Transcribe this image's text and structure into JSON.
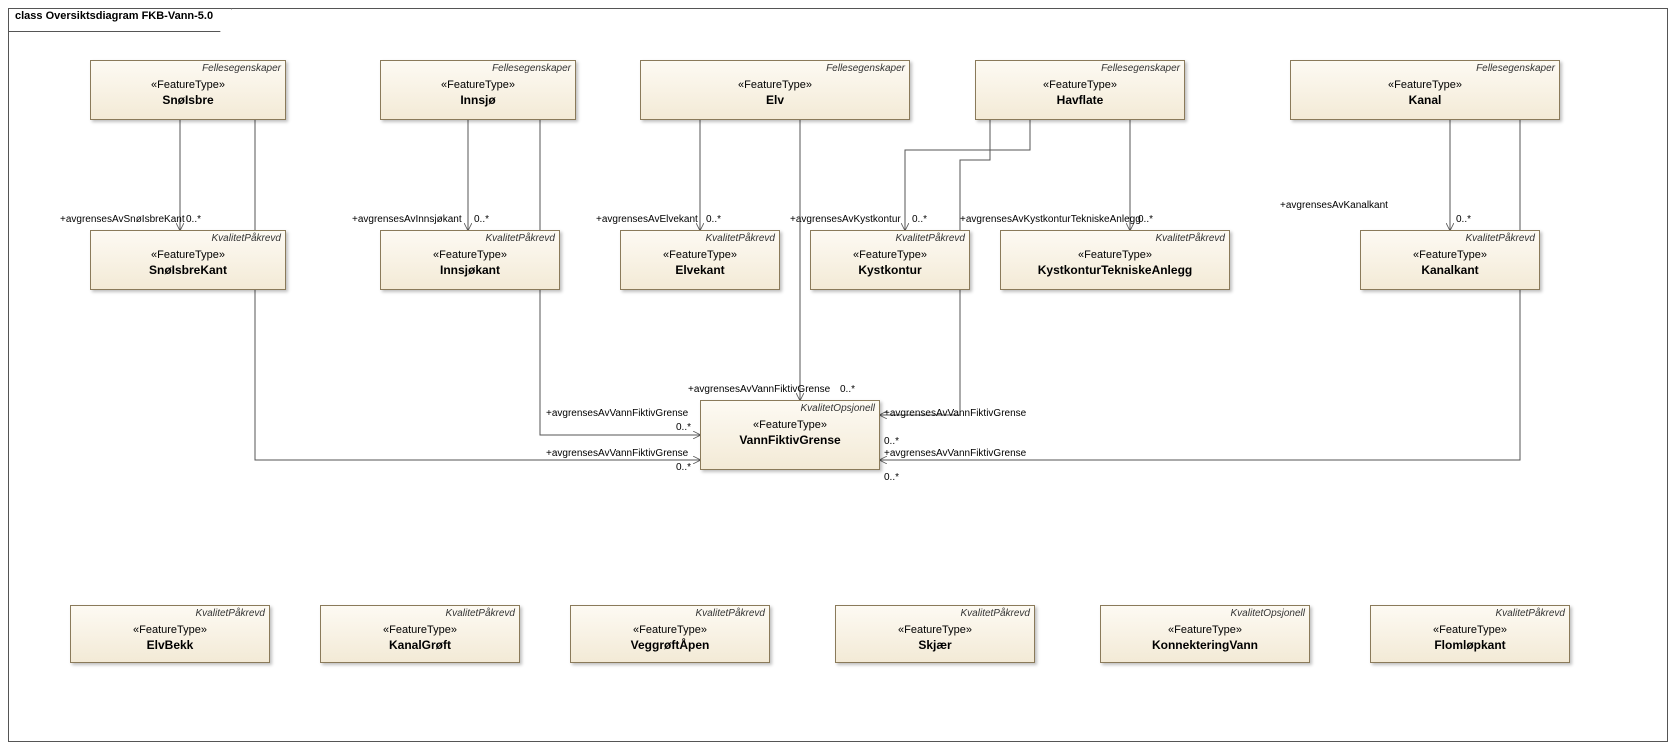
{
  "diagram": {
    "title": "class Oversiktsdiagram FKB-Vann-5.0"
  },
  "stereotype": "«FeatureType»",
  "tags": {
    "felles": "Fellesegenskaper",
    "pakrevd": "KvalitetPåkrevd",
    "opsjonell": "KvalitetOpsjonell"
  },
  "classes": {
    "snoisbre": {
      "name": "SnøIsbre"
    },
    "innsjo": {
      "name": "Innsjø"
    },
    "elv": {
      "name": "Elv"
    },
    "havflate": {
      "name": "Havflate"
    },
    "kanal": {
      "name": "Kanal"
    },
    "snoisbrekant": {
      "name": "SnøIsbreKant"
    },
    "innsjokant": {
      "name": "Innsjøkant"
    },
    "elvekant": {
      "name": "Elvekant"
    },
    "kystkontur": {
      "name": "Kystkontur"
    },
    "kysttekn": {
      "name": "KystkonturTekniskeAnlegg"
    },
    "kanalkant": {
      "name": "Kanalkant"
    },
    "vannfiktiv": {
      "name": "VannFiktivGrense"
    },
    "elvbekk": {
      "name": "ElvBekk"
    },
    "kanalgroft": {
      "name": "KanalGrøft"
    },
    "veggroft": {
      "name": "VeggrøftÅpen"
    },
    "skjaer": {
      "name": "Skjær"
    },
    "konnektering": {
      "name": "KonnekteringVann"
    },
    "flomlopkant": {
      "name": "Flomløpkant"
    }
  },
  "assoc": {
    "snoisbrekant": {
      "role": "+avgrensesAvSnøIsbreKant",
      "mult": "0..*"
    },
    "innsjokant": {
      "role": "+avgrensesAvInnsjøkant",
      "mult": "0..*"
    },
    "elvekant": {
      "role": "+avgrensesAvElvekant",
      "mult": "0..*"
    },
    "kystkontur": {
      "role": "+avgrensesAvKystkontur",
      "mult": "0..*"
    },
    "kysttekn": {
      "role": "+avgrensesAvKystkonturTekniskeAnlegg",
      "mult": "0..*"
    },
    "kanalkant": {
      "role": "+avgrensesAvKanalkant",
      "mult": "0..*"
    },
    "fiktiv_generic": {
      "role": "+avgrensesAvVannFiktivGrense",
      "mult": "0..*"
    }
  }
}
